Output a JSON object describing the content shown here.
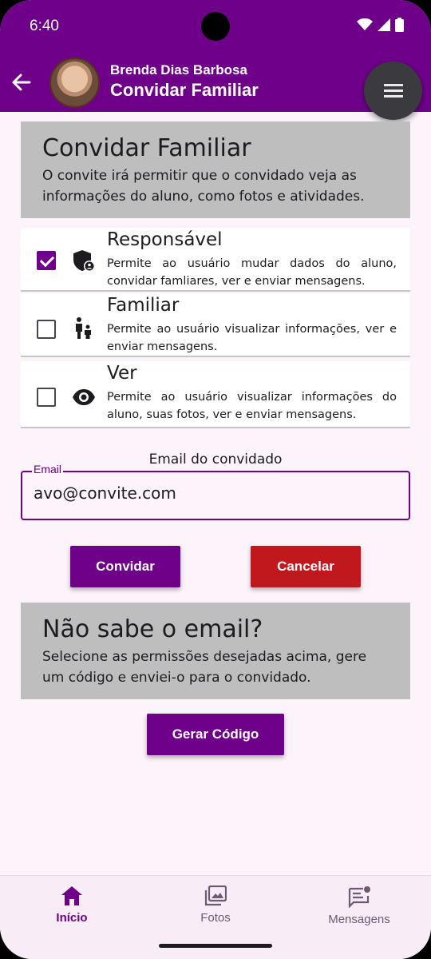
{
  "status_bar": {
    "time": "6:40"
  },
  "header": {
    "user_name": "Brenda Dias Barbosa",
    "title": "Convidar Familiar"
  },
  "intro": {
    "title": "Convidar Familiar",
    "text": "O convite irá permitir que o convidado veja as informações do aluno, como fotos e atividades."
  },
  "permissions": [
    {
      "title": "Responsável",
      "description": "Permite ao usuário mudar dados do aluno, convidar famliares, ver e enviar mensagens.",
      "checked": true,
      "icon": "shield-person-icon"
    },
    {
      "title": "Familiar",
      "description": "Permite ao usuário visualizar informações, ver e enviar mensagens.",
      "checked": false,
      "icon": "family-icon"
    },
    {
      "title": "Ver",
      "description": "Permite ao usuário visualizar informações do aluno, suas fotos, ver e enviar mensagens.",
      "checked": false,
      "icon": "eye-icon"
    }
  ],
  "email": {
    "caption": "Email do convidado",
    "label": "Email",
    "value": "avo@convite.com"
  },
  "actions": {
    "invite": "Convidar",
    "cancel": "Cancelar"
  },
  "code_section": {
    "title": "Não sabe o email?",
    "text": "Selecione as permissões desejadas acima, gere um código e enviei-o para o convidado.",
    "button": "Gerar Código"
  },
  "bottom_nav": [
    {
      "label": "Início",
      "active": true
    },
    {
      "label": "Fotos",
      "active": false
    },
    {
      "label": "Mensagens",
      "active": false
    }
  ],
  "colors": {
    "primary": "#6e008a",
    "danger": "#c0181c",
    "panel": "#bebebe",
    "background": "#fdf3fb"
  }
}
